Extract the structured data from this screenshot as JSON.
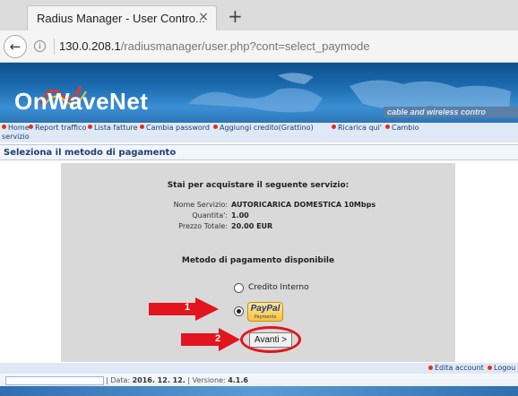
{
  "browser": {
    "tab_title": "Radius Manager - User Contro...",
    "tab_close": "×",
    "new_tab": "+",
    "back_glyph": "←",
    "info_glyph": "i",
    "url_host": "130.0.208.1",
    "url_path": "/radiusmanager/user.php?cont=select_paymode"
  },
  "header": {
    "brand": "OnWaveNet",
    "tagline": "cable and wireless contro"
  },
  "menu": {
    "items": [
      "Home",
      "Report traffico",
      "Lista fatture",
      "Cambia password",
      "Aggiungi credito(Grattino)",
      "Ricarica qui'",
      "Cambio"
    ],
    "overflow": "servizio"
  },
  "section_title": "Seleziona il metodo di pagamento",
  "panel": {
    "heading": "Stai per acquistare il seguente servizio:",
    "service_label": "Nome Servizio:",
    "service_value": "AUTORICARICA DOMESTICA 10Mbps",
    "quantity_label": "Quantita':",
    "quantity_value": "1.00",
    "price_label": "Prezzo Totale:",
    "price_value": "20.00 EUR",
    "method_heading": "Metodo di pagamento disponibile",
    "options": [
      {
        "label": "Credito Interno",
        "selected": false
      },
      {
        "label": "PayPal",
        "sub": "Payments",
        "selected": true
      }
    ],
    "submit_label": "Avanti >"
  },
  "annotations": {
    "arrow1": "1",
    "arrow2": "2",
    "color": "#e2141e"
  },
  "footer": {
    "edit_account": "Edita account",
    "logout": "Logou",
    "date_label": "Data:",
    "date_value": "2016. 12. 12.",
    "version_label": "Versione:",
    "version_value": "4.1.6"
  }
}
